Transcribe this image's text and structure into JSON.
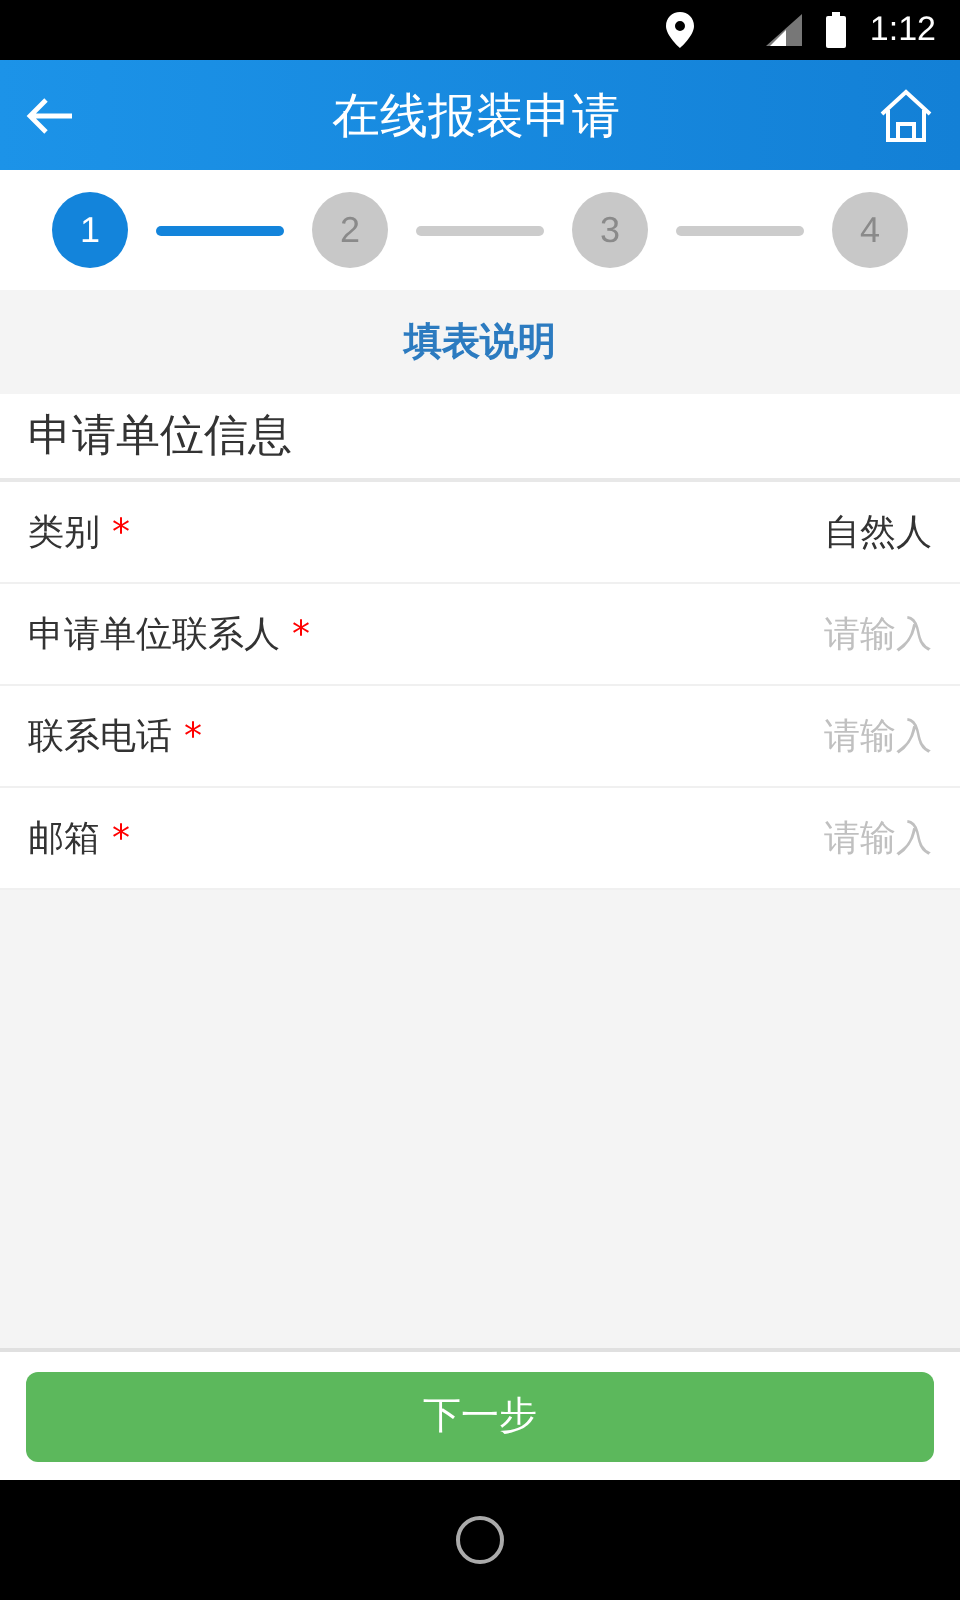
{
  "status_bar": {
    "time": "1:12"
  },
  "header": {
    "title": "在线报装申请"
  },
  "steps": [
    {
      "label": "1",
      "selected": true
    },
    {
      "label": "2",
      "selected": false
    },
    {
      "label": "3",
      "selected": false
    },
    {
      "label": "4",
      "selected": false
    }
  ],
  "instructions_link": "填表说明",
  "section_title": "申请单位信息",
  "fields": [
    {
      "kind": "select",
      "label": "类别",
      "required_mark": "*",
      "value": "自然人"
    },
    {
      "kind": "input",
      "label": "申请单位联系人",
      "required_mark": "*",
      "placeholder": "请输入"
    },
    {
      "kind": "input",
      "label": "联系电话",
      "required_mark": "*",
      "placeholder": "请输入"
    },
    {
      "kind": "input",
      "label": "邮箱",
      "required_mark": "*",
      "placeholder": "请输入"
    }
  ],
  "next_button": "下一步"
}
